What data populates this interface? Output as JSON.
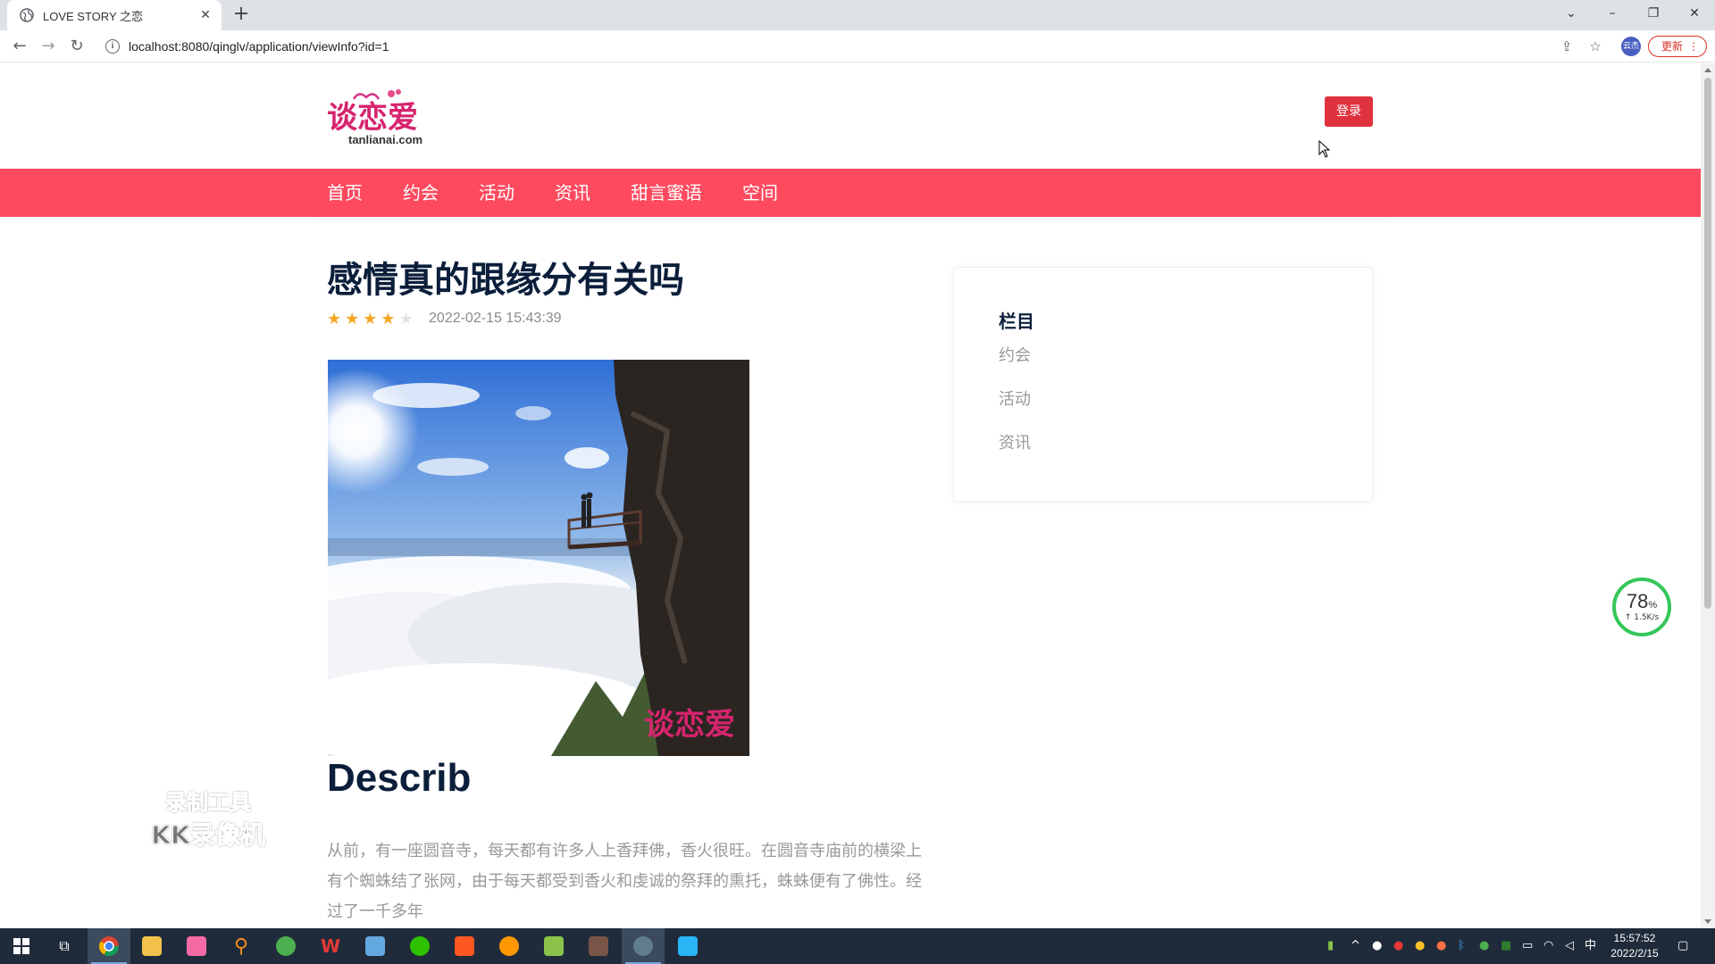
{
  "browser": {
    "tab_title": "LOVE STORY 之恋",
    "url": "localhost:8080/qinglv/application/viewInfo?id=1",
    "update_label": "更新",
    "profile_label": "云杰"
  },
  "site": {
    "logo_text": "谈恋爱",
    "logo_subtext": "tanlianai.com",
    "login_label": "登录",
    "nav": [
      "首页",
      "约会",
      "活动",
      "资讯",
      "甜言蜜语",
      "空间"
    ]
  },
  "article": {
    "title": "感情真的跟缘分有关吗",
    "rating": 4,
    "rating_max": 5,
    "date": "2022-02-15 15:43:39",
    "image_watermark": "谈恋爱",
    "section_title": "Describ",
    "description": "从前，有一座圆音寺，每天都有许多人上香拜佛，香火很旺。在圆音寺庙前的横梁上有个蜘蛛结了张网，由于每天都受到香火和虔诚的祭拜的熏托，蛛蛛便有了佛性。经过了一千多年"
  },
  "sidebar": {
    "title": "栏目",
    "items": [
      "约会",
      "活动",
      "资讯"
    ]
  },
  "overlay": {
    "watermark_line1": "录制工具",
    "watermark_line2": "KK录像机",
    "net_percent": "78",
    "net_percent_unit": "%",
    "net_speed": "↑ 1.5K/s"
  },
  "taskbar": {
    "time": "15:57:52",
    "date": "2022/2/15",
    "ime": "中"
  }
}
